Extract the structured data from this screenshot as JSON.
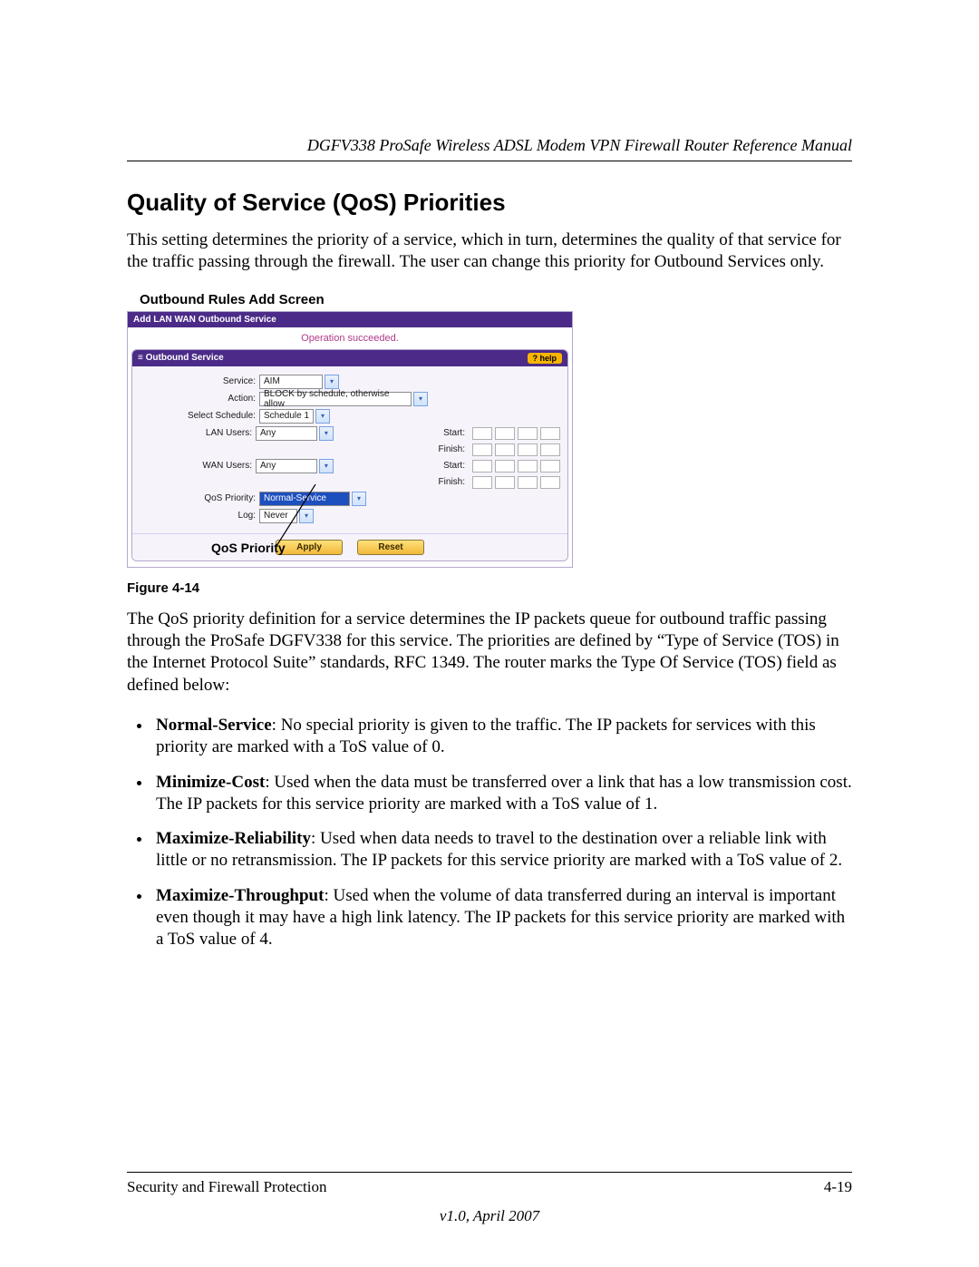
{
  "header": {
    "running_title": "DGFV338 ProSafe Wireless ADSL Modem VPN Firewall Router Reference Manual"
  },
  "section": {
    "title": "Quality of Service (QoS) Priorities",
    "intro": "This setting determines the priority of a service, which in turn, determines the quality of that service for the traffic passing through the firewall. The user can change this priority for Outbound Services only."
  },
  "figure": {
    "caption": "Outbound Rules Add Screen",
    "callout": "QoS Priority",
    "label": "Figure 4-14"
  },
  "screenshot": {
    "tab": "Add LAN WAN Outbound Service",
    "status": "Operation succeeded.",
    "panel_title": "Outbound Service",
    "help": "? help",
    "fields": {
      "service_label": "Service:",
      "service_value": "AIM",
      "action_label": "Action:",
      "action_value": "BLOCK by schedule, otherwise allow",
      "schedule_label": "Select Schedule:",
      "schedule_value": "Schedule 1",
      "lan_label": "LAN Users:",
      "lan_value": "Any",
      "wan_label": "WAN Users:",
      "wan_value": "Any",
      "start_label": "Start:",
      "finish_label": "Finish:",
      "qos_label": "QoS Priority:",
      "qos_value": "Normal-Service",
      "log_label": "Log:",
      "log_value": "Never"
    },
    "buttons": {
      "apply": "Apply",
      "reset": "Reset"
    }
  },
  "post_figure_para": "The QoS priority definition for a service determines the IP packets queue for outbound traffic passing through the ProSafe DGFV338 for this service. The priorities are defined by “Type of Service (TOS) in the Internet Protocol Suite” standards, RFC 1349. The router marks the Type Of Service (TOS) field as defined below:",
  "bullets": [
    {
      "term": "Normal-Service",
      "text": ": No special priority is given to the traffic. The IP packets for services with this priority are marked with a ToS value of 0."
    },
    {
      "term": "Minimize-Cost",
      "text": ": Used when the data must be transferred over a link that has a low transmission cost. The IP packets for this service priority are marked with a ToS value of 1."
    },
    {
      "term": "Maximize-Reliability",
      "text": ": Used when data needs to travel to the destination over a reliable link with little or no retransmission. The IP packets for this service priority are marked with a ToS value of 2."
    },
    {
      "term": "Maximize-Throughput",
      "text": ": Used when the volume of data transferred during an interval is important even though it may have a high link latency. The IP packets for this service priority are marked with a ToS value of 4."
    }
  ],
  "footer": {
    "left": "Security and Firewall Protection",
    "right": "4-19",
    "version": "v1.0, April 2007"
  }
}
